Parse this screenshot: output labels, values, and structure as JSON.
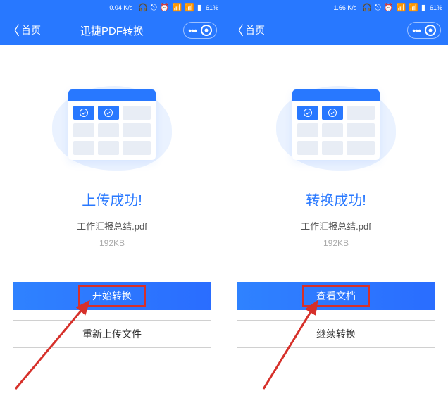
{
  "left": {
    "status": {
      "speed": "0.04 K/s",
      "battery": "61%"
    },
    "header": {
      "back": "首页",
      "title": "迅捷PDF转换"
    },
    "status_title": "上传成功!",
    "filename": "工作汇报总结.pdf",
    "filesize": "192KB",
    "primary_btn": "开始转换",
    "secondary_btn": "重新上传文件"
  },
  "right": {
    "status": {
      "speed": "1.66 K/s",
      "battery": "61%"
    },
    "header": {
      "back": "首页",
      "title": ""
    },
    "status_title": "转换成功!",
    "filename": "工作汇报总结.pdf",
    "filesize": "192KB",
    "primary_btn": "查看文档",
    "secondary_btn": "继续转换"
  }
}
